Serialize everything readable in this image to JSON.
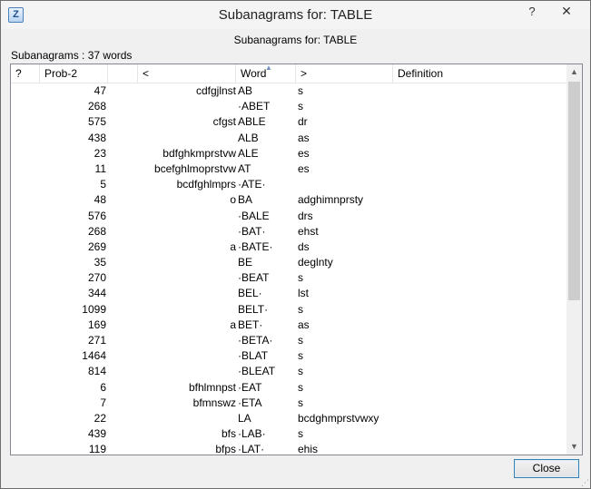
{
  "window": {
    "title": "Subanagrams for: TABLE",
    "icon_letter": "Z",
    "help_glyph": "?",
    "close_glyph": "✕"
  },
  "dialog": {
    "header": "Subanagrams for: TABLE",
    "count_label": "Subanagrams : 37 words"
  },
  "columns": [
    "?",
    "Prob-2",
    "",
    "<",
    "Word",
    ">",
    "Definition"
  ],
  "rows": [
    {
      "prob": "47",
      "front": "cdfgjlnst",
      "word": "AB",
      "back": "s"
    },
    {
      "prob": "268",
      "front": "",
      "word": "·ABET",
      "back": "s"
    },
    {
      "prob": "575",
      "front": "cfgst",
      "word": "ABLE",
      "back": "dr"
    },
    {
      "prob": "438",
      "front": "",
      "word": "ALB",
      "back": "as"
    },
    {
      "prob": "23",
      "front": "bdfghkmprstvw",
      "word": "ALE",
      "back": "es"
    },
    {
      "prob": "11",
      "front": "bcefghlmoprstvw",
      "word": "AT",
      "back": "es"
    },
    {
      "prob": "5",
      "front": "bcdfghlmprs",
      "word": "·ATE·",
      "back": ""
    },
    {
      "prob": "48",
      "front": "o",
      "word": "BA",
      "back": "adghimnprsty"
    },
    {
      "prob": "576",
      "front": "",
      "word": "·BALE",
      "back": "drs"
    },
    {
      "prob": "268",
      "front": "",
      "word": "·BAT·",
      "back": "ehst"
    },
    {
      "prob": "269",
      "front": "a",
      "word": "·BATE·",
      "back": "ds"
    },
    {
      "prob": "35",
      "front": "",
      "word": "BE",
      "back": "deglnty"
    },
    {
      "prob": "270",
      "front": "",
      "word": "·BEAT",
      "back": "s"
    },
    {
      "prob": "344",
      "front": "",
      "word": "BEL·",
      "back": "lst"
    },
    {
      "prob": "1099",
      "front": "",
      "word": "BELT·",
      "back": "s"
    },
    {
      "prob": "169",
      "front": "a",
      "word": "BET·",
      "back": "as"
    },
    {
      "prob": "271",
      "front": "",
      "word": "·BETA·",
      "back": "s"
    },
    {
      "prob": "1464",
      "front": "",
      "word": "·BLAT",
      "back": "s"
    },
    {
      "prob": "814",
      "front": "",
      "word": "·BLEAT",
      "back": "s"
    },
    {
      "prob": "6",
      "front": "bfhlmnpst",
      "word": "·EAT",
      "back": "s"
    },
    {
      "prob": "7",
      "front": "bfmnswz",
      "word": "·ETA",
      "back": "s"
    },
    {
      "prob": "22",
      "front": "",
      "word": "LA",
      "back": "bcdghmprstvwxy"
    },
    {
      "prob": "439",
      "front": "bfs",
      "word": "·LAB·",
      "back": "s"
    },
    {
      "prob": "119",
      "front": "bfps",
      "word": "·LAT·",
      "back": "ehis"
    }
  ],
  "buttons": {
    "close": "Close"
  },
  "icons": {
    "scroll_up": "▲",
    "scroll_down": "▼",
    "sort": "▲",
    "grip": "⋰"
  }
}
